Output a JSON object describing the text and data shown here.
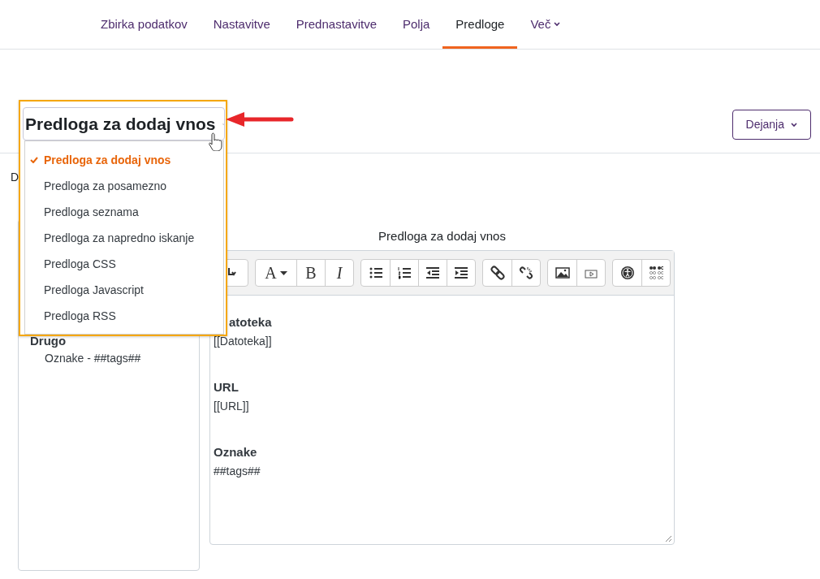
{
  "nav": {
    "tabs": [
      {
        "label": "Zbirka podatkov",
        "selected": false,
        "kind": "link"
      },
      {
        "label": "Nastavitve",
        "selected": false,
        "kind": "link"
      },
      {
        "label": "Prednastavitve",
        "selected": false,
        "kind": "link"
      },
      {
        "label": "Polja",
        "selected": false,
        "kind": "link"
      },
      {
        "label": "Predloge",
        "selected": true,
        "kind": "link"
      },
      {
        "label": "Več",
        "selected": false,
        "kind": "menu"
      }
    ]
  },
  "template_select": {
    "value": "Predloga za dodaj vnos",
    "options": [
      {
        "label": "Predloga za dodaj vnos",
        "selected": true
      },
      {
        "label": "Predloga za posamezno",
        "selected": false
      },
      {
        "label": "Predloga seznama",
        "selected": false
      },
      {
        "label": "Predloga za napredno iskanje",
        "selected": false
      },
      {
        "label": "Predloga CSS",
        "selected": false
      },
      {
        "label": "Predloga Javascript",
        "selected": false
      },
      {
        "label": "Predloga RSS",
        "selected": false
      }
    ]
  },
  "actions_button": "Dejanja",
  "left_panel": {
    "cut_text": "D",
    "section": "Drugo",
    "items": [
      "Oznake - ##tags##"
    ]
  },
  "editor": {
    "label": "Predloga za dodaj vnos",
    "toolbar_groups": [
      [
        {
          "kind": "partial"
        }
      ],
      [
        {
          "kind": "font",
          "label": "A"
        },
        {
          "kind": "bold",
          "label": "B"
        },
        {
          "kind": "italic",
          "label": "I"
        }
      ],
      [
        {
          "kind": "bullets"
        },
        {
          "kind": "numbers"
        },
        {
          "kind": "outdent"
        },
        {
          "kind": "indent"
        }
      ],
      [
        {
          "kind": "link"
        },
        {
          "kind": "unlink"
        }
      ],
      [
        {
          "kind": "image"
        },
        {
          "kind": "media"
        }
      ],
      [
        {
          "kind": "accessibility"
        },
        {
          "kind": "braille"
        }
      ]
    ],
    "fields": [
      {
        "heading": "atoteka",
        "value": "[[Datoteka]]"
      },
      {
        "heading": "URL",
        "value": "[[URL]]"
      },
      {
        "heading": "Oznake",
        "value": "##tags##"
      }
    ]
  }
}
